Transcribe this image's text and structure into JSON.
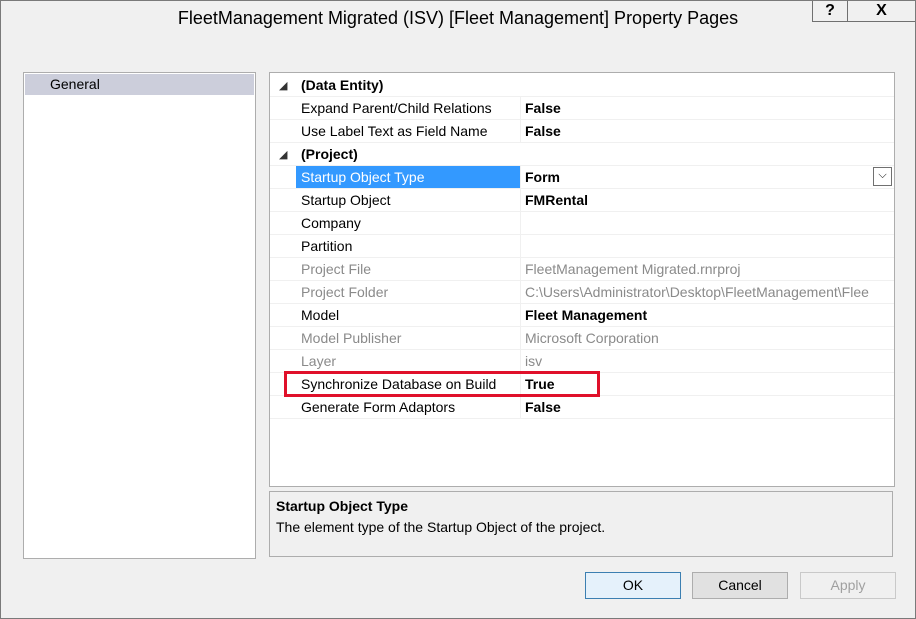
{
  "window": {
    "title": "FleetManagement Migrated (ISV) [Fleet Management] Property Pages",
    "help_label": "?",
    "close_label": "X"
  },
  "nav": {
    "items": [
      {
        "label": "General",
        "selected": true
      }
    ]
  },
  "grid": {
    "rows": [
      {
        "kind": "category",
        "name": "(Data Entity)"
      },
      {
        "name": "Expand Parent/Child Relations",
        "value": "False",
        "bold": true
      },
      {
        "name": "Use Label Text as Field Name",
        "value": "False",
        "bold": true
      },
      {
        "kind": "category",
        "name": "(Project)"
      },
      {
        "name": "Startup Object Type",
        "value": "Form",
        "bold": true,
        "selected": true,
        "dropdown": true
      },
      {
        "name": "Startup Object",
        "value": "FMRental",
        "bold": true
      },
      {
        "name": "Company",
        "value": ""
      },
      {
        "name": "Partition",
        "value": ""
      },
      {
        "name": "Project File",
        "value": "FleetManagement Migrated.rnrproj",
        "readonly": true
      },
      {
        "name": "Project Folder",
        "value": "C:\\Users\\Administrator\\Desktop\\FleetManagement\\Flee",
        "readonly": true
      },
      {
        "name": "Model",
        "value": "Fleet Management",
        "bold": true
      },
      {
        "name": "Model Publisher",
        "value": "Microsoft Corporation",
        "readonly": true
      },
      {
        "name": "Layer",
        "value": "isv",
        "readonly": true
      },
      {
        "name": "Synchronize Database on Build",
        "value": "True",
        "bold": true,
        "highlighted": true
      },
      {
        "name": "Generate Form Adaptors",
        "value": "False",
        "bold": true
      }
    ],
    "collapse_glyph": "◢",
    "dropdown_glyph": "⌵"
  },
  "description": {
    "title": "Startup Object Type",
    "text": "The element type of the Startup Object of the project."
  },
  "buttons": {
    "ok": "OK",
    "cancel": "Cancel",
    "apply": "Apply"
  },
  "colors": {
    "selection": "#3399ff",
    "highlight_box": "#e0102a",
    "nav_selected": "#cccedb"
  }
}
